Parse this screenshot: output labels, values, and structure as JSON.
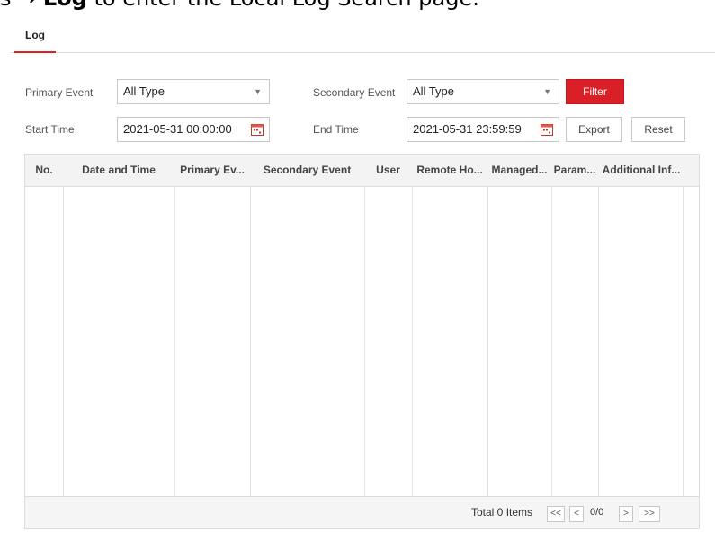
{
  "doc_heading": {
    "prefix": "s → ",
    "bold": "Log",
    "rest": " to enter the Local Log Search page."
  },
  "tabs": [
    {
      "label": "Log",
      "active": true
    }
  ],
  "filters": {
    "primary_event_label": "Primary Event",
    "primary_event_value": "All Type",
    "secondary_event_label": "Secondary Event",
    "secondary_event_value": "All Type",
    "start_time_label": "Start Time",
    "start_time_value": "2021-05-31 00:00:00",
    "end_time_label": "End Time",
    "end_time_value": "2021-05-31 23:59:59",
    "filter_button": "Filter",
    "export_button": "Export",
    "reset_button": "Reset"
  },
  "table": {
    "columns": [
      "No.",
      "Date and Time",
      "Primary Ev...",
      "Secondary Event",
      "User",
      "Remote Ho...",
      "Managed...",
      "Param...",
      "Additional Inf..."
    ],
    "rows": []
  },
  "pagination": {
    "total_text": "Total 0 Items",
    "first": "<<",
    "prev": "<",
    "page_info": "0/0",
    "next": ">",
    "last": ">>"
  },
  "colors": {
    "accent": "#da1f26",
    "header_bg": "#f3f3f3",
    "border": "#dcdcdc"
  },
  "icons": {
    "dropdown": "chevron-down-icon",
    "calendar": "calendar-icon"
  }
}
